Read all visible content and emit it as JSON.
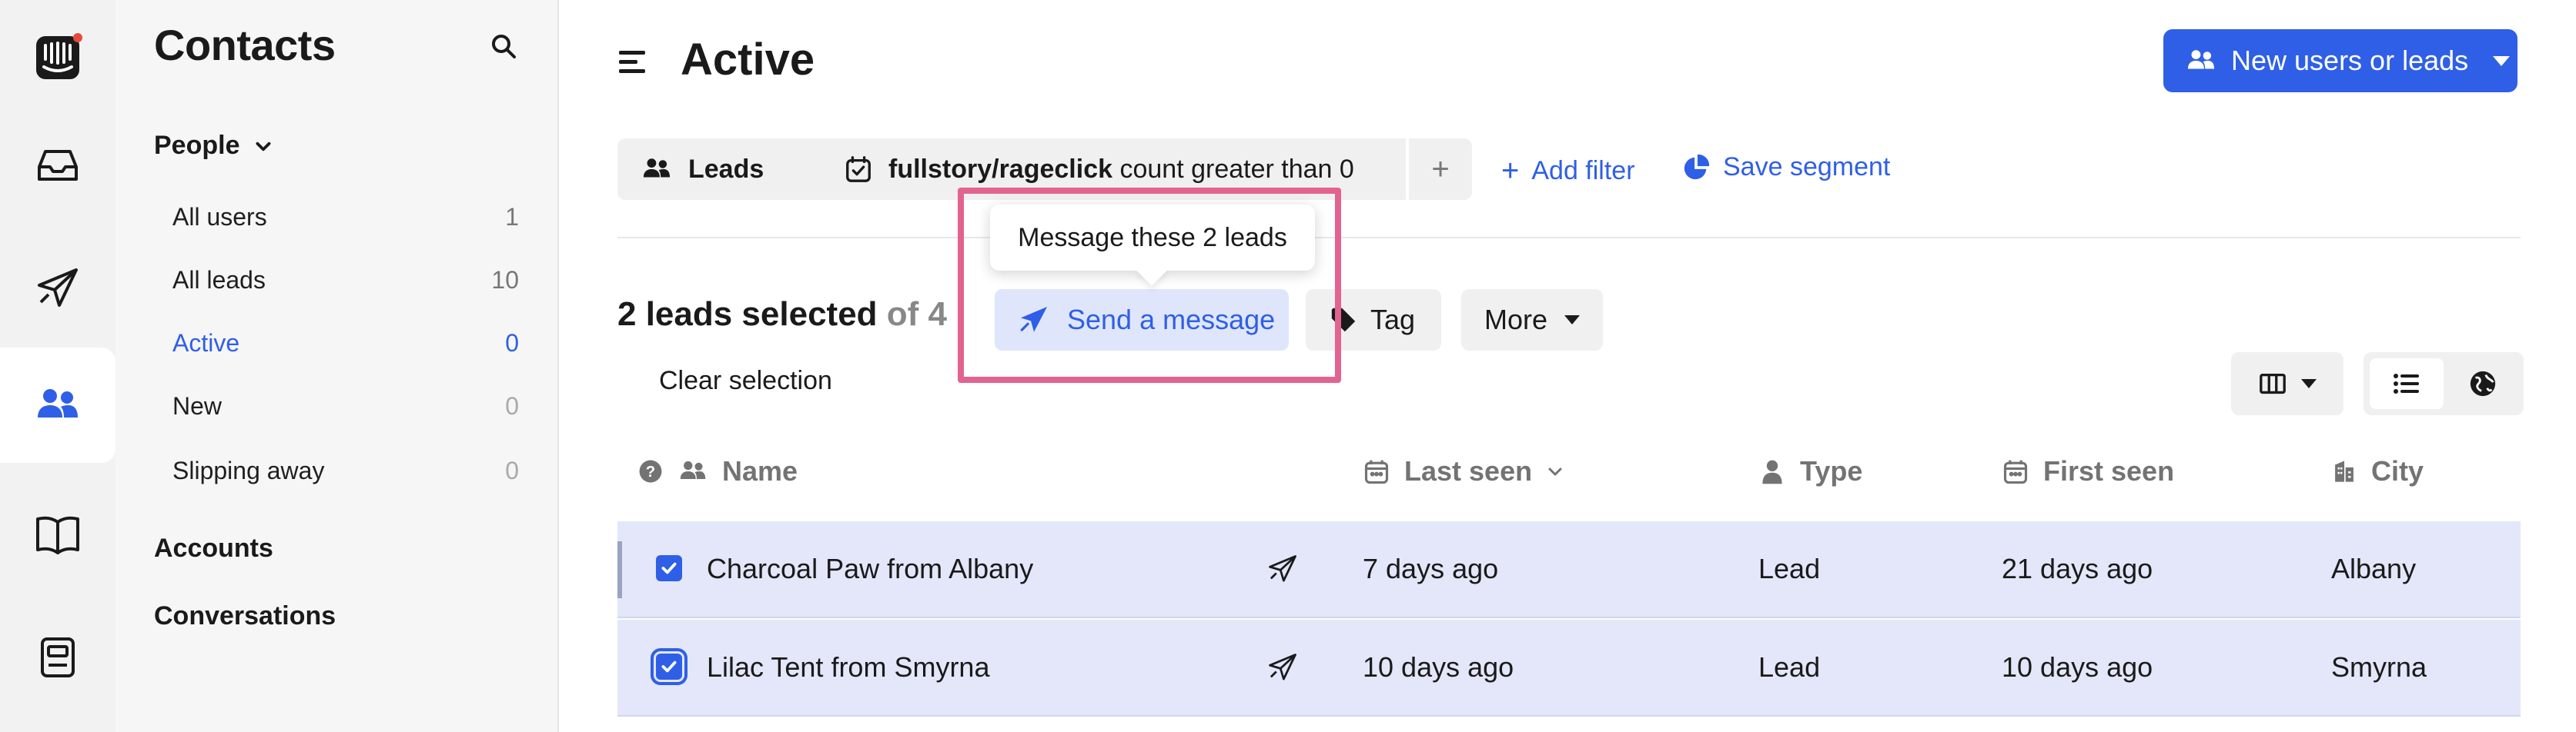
{
  "sidebar": {
    "title": "Contacts",
    "people_label": "People",
    "segments": [
      {
        "label": "All users",
        "count": "1"
      },
      {
        "label": "All leads",
        "count": "10"
      },
      {
        "label": "Active",
        "count": "0"
      },
      {
        "label": "New",
        "count": "0"
      },
      {
        "label": "Slipping away",
        "count": "0"
      }
    ],
    "accounts_label": "Accounts",
    "conversations_label": "Conversations"
  },
  "header": {
    "title": "Active",
    "new_button_label": "New users or leads"
  },
  "filters": {
    "audience_label": "Leads",
    "filter_attribute": "fullstory/rageclick",
    "filter_condition": "count greater than 0",
    "plus_label": "+",
    "add_filter_label": "Add filter",
    "save_segment_label": "Save segment"
  },
  "selection": {
    "selected_text": "2 leads selected",
    "of_text": "of 4",
    "send_message_label": "Send a message",
    "tag_label": "Tag",
    "more_label": "More",
    "clear_label": "Clear selection",
    "tooltip_text": "Message these 2 leads"
  },
  "table": {
    "headers": {
      "name": "Name",
      "last_seen": "Last seen",
      "type": "Type",
      "first_seen": "First seen",
      "city": "City"
    },
    "rows": [
      {
        "name": "Charcoal Paw from Albany",
        "last_seen": "7 days ago",
        "type": "Lead",
        "first_seen": "21 days ago",
        "city": "Albany"
      },
      {
        "name": "Lilac Tent from Smyrna",
        "last_seen": "10 days ago",
        "type": "Lead",
        "first_seen": "10 days ago",
        "city": "Smyrna"
      }
    ]
  },
  "colors": {
    "accent": "#2f5fe6",
    "highlight": "#e26390",
    "selected_row": "#e3e7f9"
  }
}
